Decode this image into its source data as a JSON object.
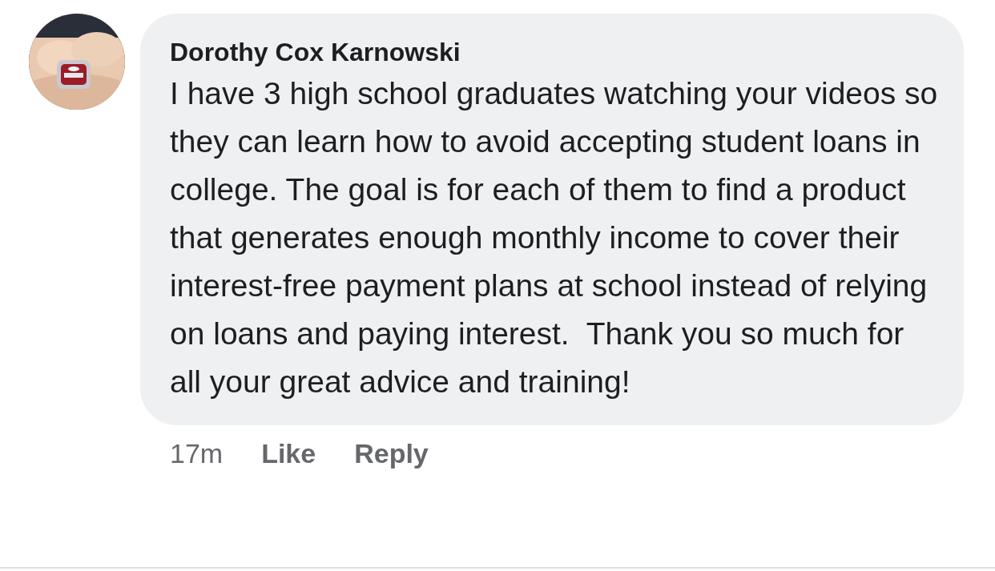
{
  "comment": {
    "author": "Dorothy Cox Karnowski",
    "text": "I have 3 high school graduates watching your videos so they can learn how to avoid accepting student loans in college. The goal is for each of them to find a product that generates enough monthly income to cover their interest-free payment plans at school instead of relying on loans and paying interest.  Thank you so much for all your great advice and training!",
    "time": "17m",
    "actions": [
      "Like",
      "Reply"
    ]
  }
}
